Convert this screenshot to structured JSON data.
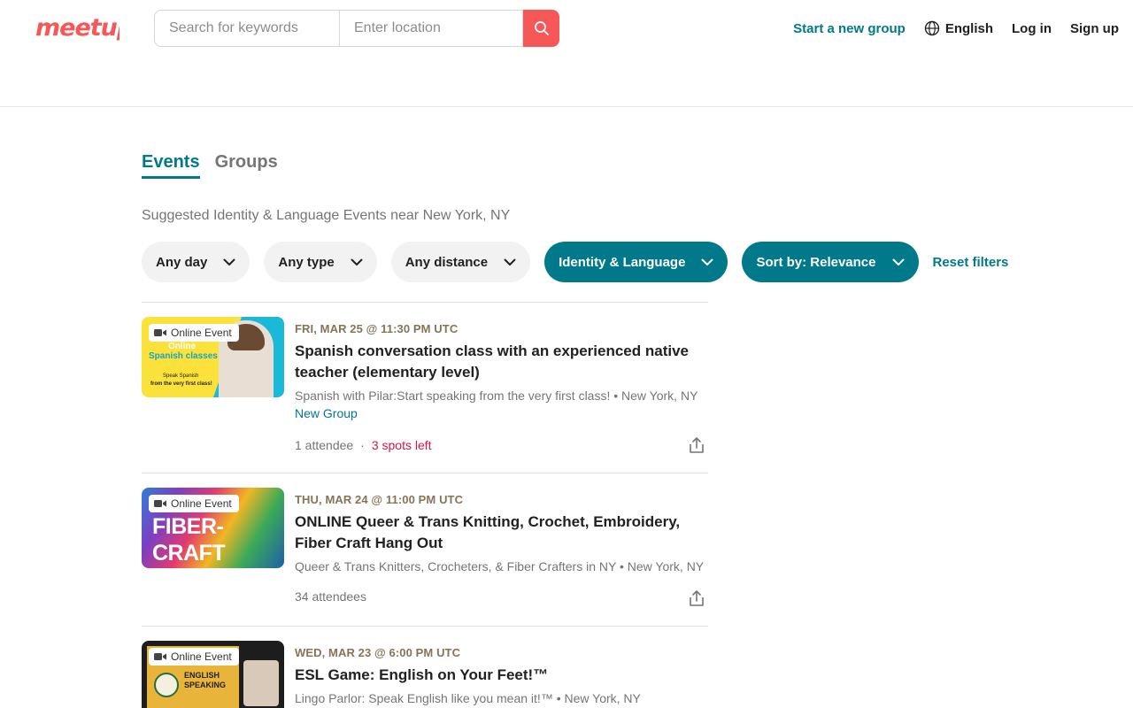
{
  "header": {
    "logo_text": "meetup",
    "search_placeholder": "Search for keywords",
    "location_placeholder": "Enter location",
    "start_group": "Start a new group",
    "language": "English",
    "login": "Log in",
    "signup": "Sign up"
  },
  "tabs": [
    {
      "label": "Events",
      "active": true
    },
    {
      "label": "Groups",
      "active": false
    }
  ],
  "suggestion_text": "Suggested Identity & Language Events near New York, NY",
  "filters": [
    {
      "label": "Any day"
    },
    {
      "label": "Any type"
    },
    {
      "label": "Any distance"
    },
    {
      "label": "Identity & Language"
    },
    {
      "label": "Sort by: Relevance"
    }
  ],
  "reset_filters": "Reset filters",
  "events": [
    {
      "badge": "Online Event",
      "thumb_text_1": "Online",
      "thumb_text_2": "Spanish classes",
      "thumb_text_3": "Speak Spanish",
      "thumb_text_4": "from the very first class!",
      "date": "FRI, MAR 25 @ 11:30 PM UTC",
      "title": "Spanish conversation class with an experienced native teacher (elementary level)",
      "group": "Spanish with Pilar:Start speaking from the very first class! • New York, NY",
      "new_group": "New Group",
      "attendees": "1 attendee",
      "spots": "3 spots left"
    },
    {
      "badge": "Online Event",
      "thumb_text_1": "FIBER-",
      "thumb_text_2": "CRAFT",
      "date": "THU, MAR 24 @ 11:00 PM UTC",
      "title": "ONLINE Queer & Trans Knitting, Crochet, Embroidery, Fiber Craft Hang Out",
      "group": "Queer & Trans Knitters, Crocheters, & Fiber Crafters in NY • New York, NY",
      "attendees": "34 attendees"
    },
    {
      "badge": "Online Event",
      "thumb_text_1": "ENGLISH",
      "thumb_text_2": "SPEAKING",
      "date": "WED, MAR 23 @ 6:00 PM UTC",
      "title": "ESL Game: English on Your Feet!™",
      "group": "Lingo Parlor: Speak English like you mean it!™ • New York, NY"
    }
  ],
  "colors": {
    "brand": "#f65858",
    "teal": "#00798a",
    "date": "#877457",
    "spots": "#d2174a"
  }
}
